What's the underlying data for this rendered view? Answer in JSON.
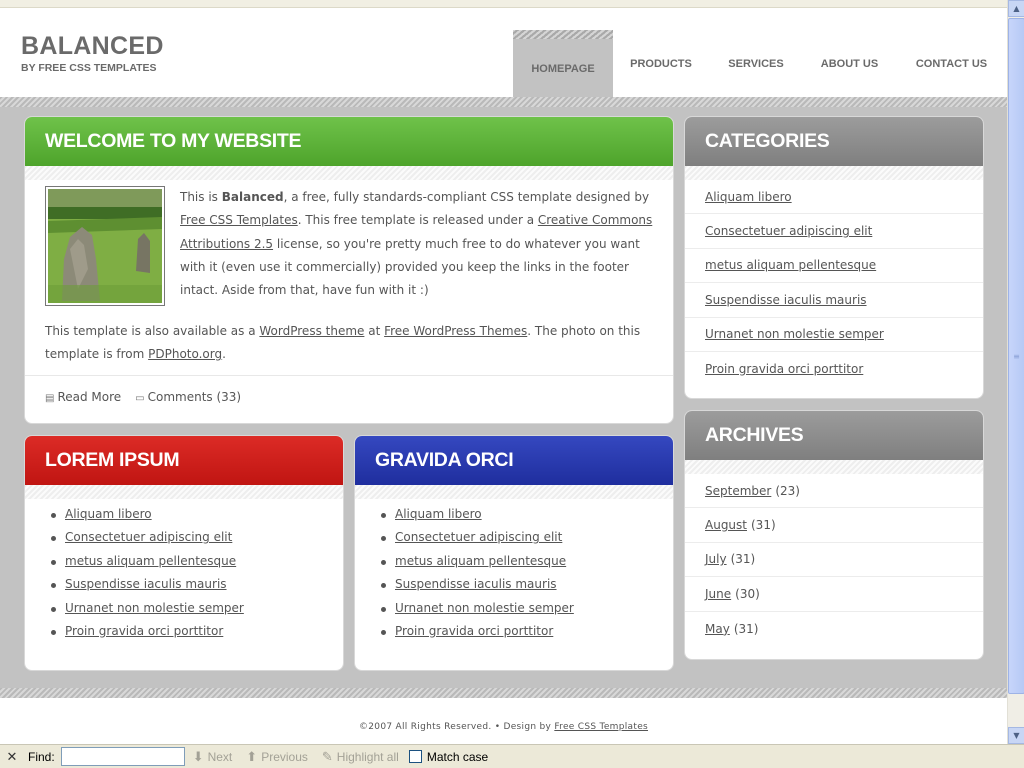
{
  "header": {
    "title": "BALANCED",
    "subtitle": "BY FREE CSS TEMPLATES",
    "menu": [
      "HOMEPAGE",
      "PRODUCTS",
      "SERVICES",
      "ABOUT US",
      "CONTACT US"
    ]
  },
  "welcome": {
    "title": "WELCOME TO MY WEBSITE",
    "p1_a": "This is ",
    "p1_bold": "Balanced",
    "p1_b": ", a free, fully standards-compliant CSS template designed by ",
    "p1_link1": "Free CSS Templates",
    "p1_c": ". This free template is released under a ",
    "p1_link2": "Creative Commons Attributions 2.5",
    "p1_d": " license, so you're pretty much free to do whatever you want with it (even use it commercially) provided you keep the links in the footer intact. Aside from that, have fun with it :)",
    "p2_a": "This template is also available as a ",
    "p2_link1": "WordPress theme",
    "p2_b": " at ",
    "p2_link2": "Free WordPress Themes",
    "p2_c": ". The photo on this template is from ",
    "p2_link3": "PDPhoto.org",
    "p2_d": ".",
    "read_more": "Read More",
    "comments": "Comments (33)"
  },
  "lorem": {
    "title": "LOREM IPSUM",
    "items": [
      "Aliquam libero",
      "Consectetuer adipiscing elit",
      "metus aliquam pellentesque",
      "Suspendisse iaculis mauris",
      "Urnanet non molestie semper",
      "Proin gravida orci porttitor"
    ]
  },
  "gravida": {
    "title": "GRAVIDA ORCI",
    "items": [
      "Aliquam libero",
      "Consectetuer adipiscing elit",
      "metus aliquam pellentesque",
      "Suspendisse iaculis mauris",
      "Urnanet non molestie semper",
      "Proin gravida orci porttitor"
    ]
  },
  "categories": {
    "title": "CATEGORIES",
    "items": [
      "Aliquam libero",
      "Consectetuer adipiscing elit",
      "metus aliquam pellentesque",
      "Suspendisse iaculis mauris",
      "Urnanet non molestie semper",
      "Proin gravida orci porttitor"
    ]
  },
  "archives": {
    "title": "ARCHIVES",
    "items": [
      {
        "month": "September",
        "count": "(23)"
      },
      {
        "month": "August",
        "count": "(31)"
      },
      {
        "month": "July",
        "count": "(31)"
      },
      {
        "month": "June",
        "count": "(30)"
      },
      {
        "month": "May",
        "count": "(31)"
      }
    ]
  },
  "footer": {
    "copyright": "©2007 All Rights Reserved.  •  Design by ",
    "link": "Free CSS Templates"
  },
  "findbar": {
    "close": "✕",
    "label": "Find:",
    "next": "Next",
    "previous": "Previous",
    "highlight": "Highlight all",
    "match_case": "Match case"
  },
  "colors": {
    "green": "#5ab236",
    "red": "#cf1e1b",
    "blue": "#283aaf",
    "grey": "#8c8c8c"
  }
}
